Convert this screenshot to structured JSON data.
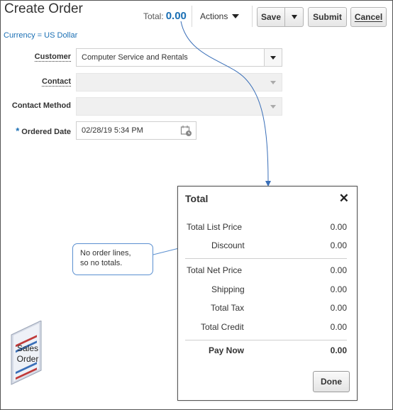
{
  "header": {
    "title": "Create Order",
    "total_label": "Total:",
    "total_value": "0.00",
    "actions_label": "Actions",
    "save_label": "Save",
    "submit_label": "Submit",
    "cancel_label": "Cancel",
    "currency": "Currency = US Dollar"
  },
  "form": {
    "customer_label": "Customer",
    "customer_value": "Computer Service and Rentals",
    "contact_label": "Contact",
    "contact_value": "",
    "contact_method_label": "Contact Method",
    "contact_method_value": "",
    "ordered_date_required": "*",
    "ordered_date_label": "Ordered Date",
    "ordered_date_value": "02/28/19 5:34 PM"
  },
  "callout": {
    "line1": "No order lines,",
    "line2": "so no totals."
  },
  "dialog": {
    "title": "Total",
    "close": "✕",
    "rows": [
      {
        "label": "Total List Price",
        "value": "0.00"
      },
      {
        "label": "Discount",
        "value": "0.00"
      },
      {
        "label": "Total Net Price",
        "value": "0.00"
      },
      {
        "label": "Shipping",
        "value": "0.00"
      },
      {
        "label": "Total Tax",
        "value": "0.00"
      },
      {
        "label": "Total Credit",
        "value": "0.00"
      },
      {
        "label": "Pay Now",
        "value": "0.00"
      }
    ],
    "done_label": "Done"
  },
  "sales_order": {
    "line1": "Sales",
    "line2": "Order"
  },
  "colors": {
    "accent": "#1a6fb4",
    "connector": "#3a6fb8"
  }
}
